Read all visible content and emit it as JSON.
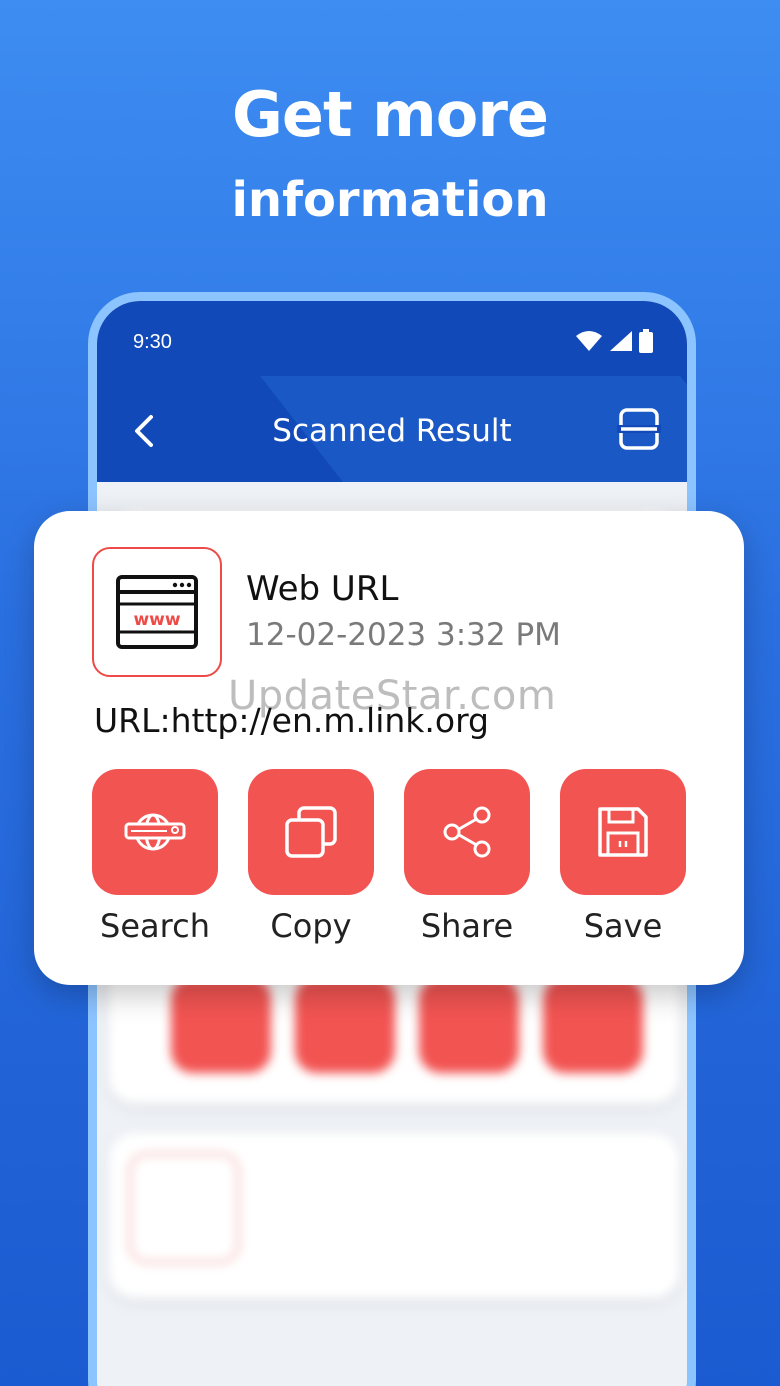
{
  "headline": {
    "line1": "Get more",
    "line2": "information"
  },
  "status_bar": {
    "time": "9:30",
    "icons": [
      "wifi-icon",
      "signal-icon",
      "battery-icon"
    ]
  },
  "app_bar": {
    "title": "Scanned Result",
    "back_icon": "chevron-left-icon",
    "right_icon": "scan-frame-icon"
  },
  "result_card": {
    "type_icon": "web-browser-www-icon",
    "type_title": "Web URL",
    "date": "12-02-2023 3:32 PM",
    "url": "URL:http://en.m.link.org",
    "actions": [
      {
        "label": "Search",
        "icon": "globe-search-icon"
      },
      {
        "label": "Copy",
        "icon": "copy-icon"
      },
      {
        "label": "Share",
        "icon": "share-icon"
      },
      {
        "label": "Save",
        "icon": "floppy-save-icon"
      }
    ]
  },
  "watermark": "UpdateStar.com",
  "colors": {
    "accent_red": "#f25452",
    "app_bar_blue": "#1149b8",
    "background_blue": "#2a6fe0"
  }
}
